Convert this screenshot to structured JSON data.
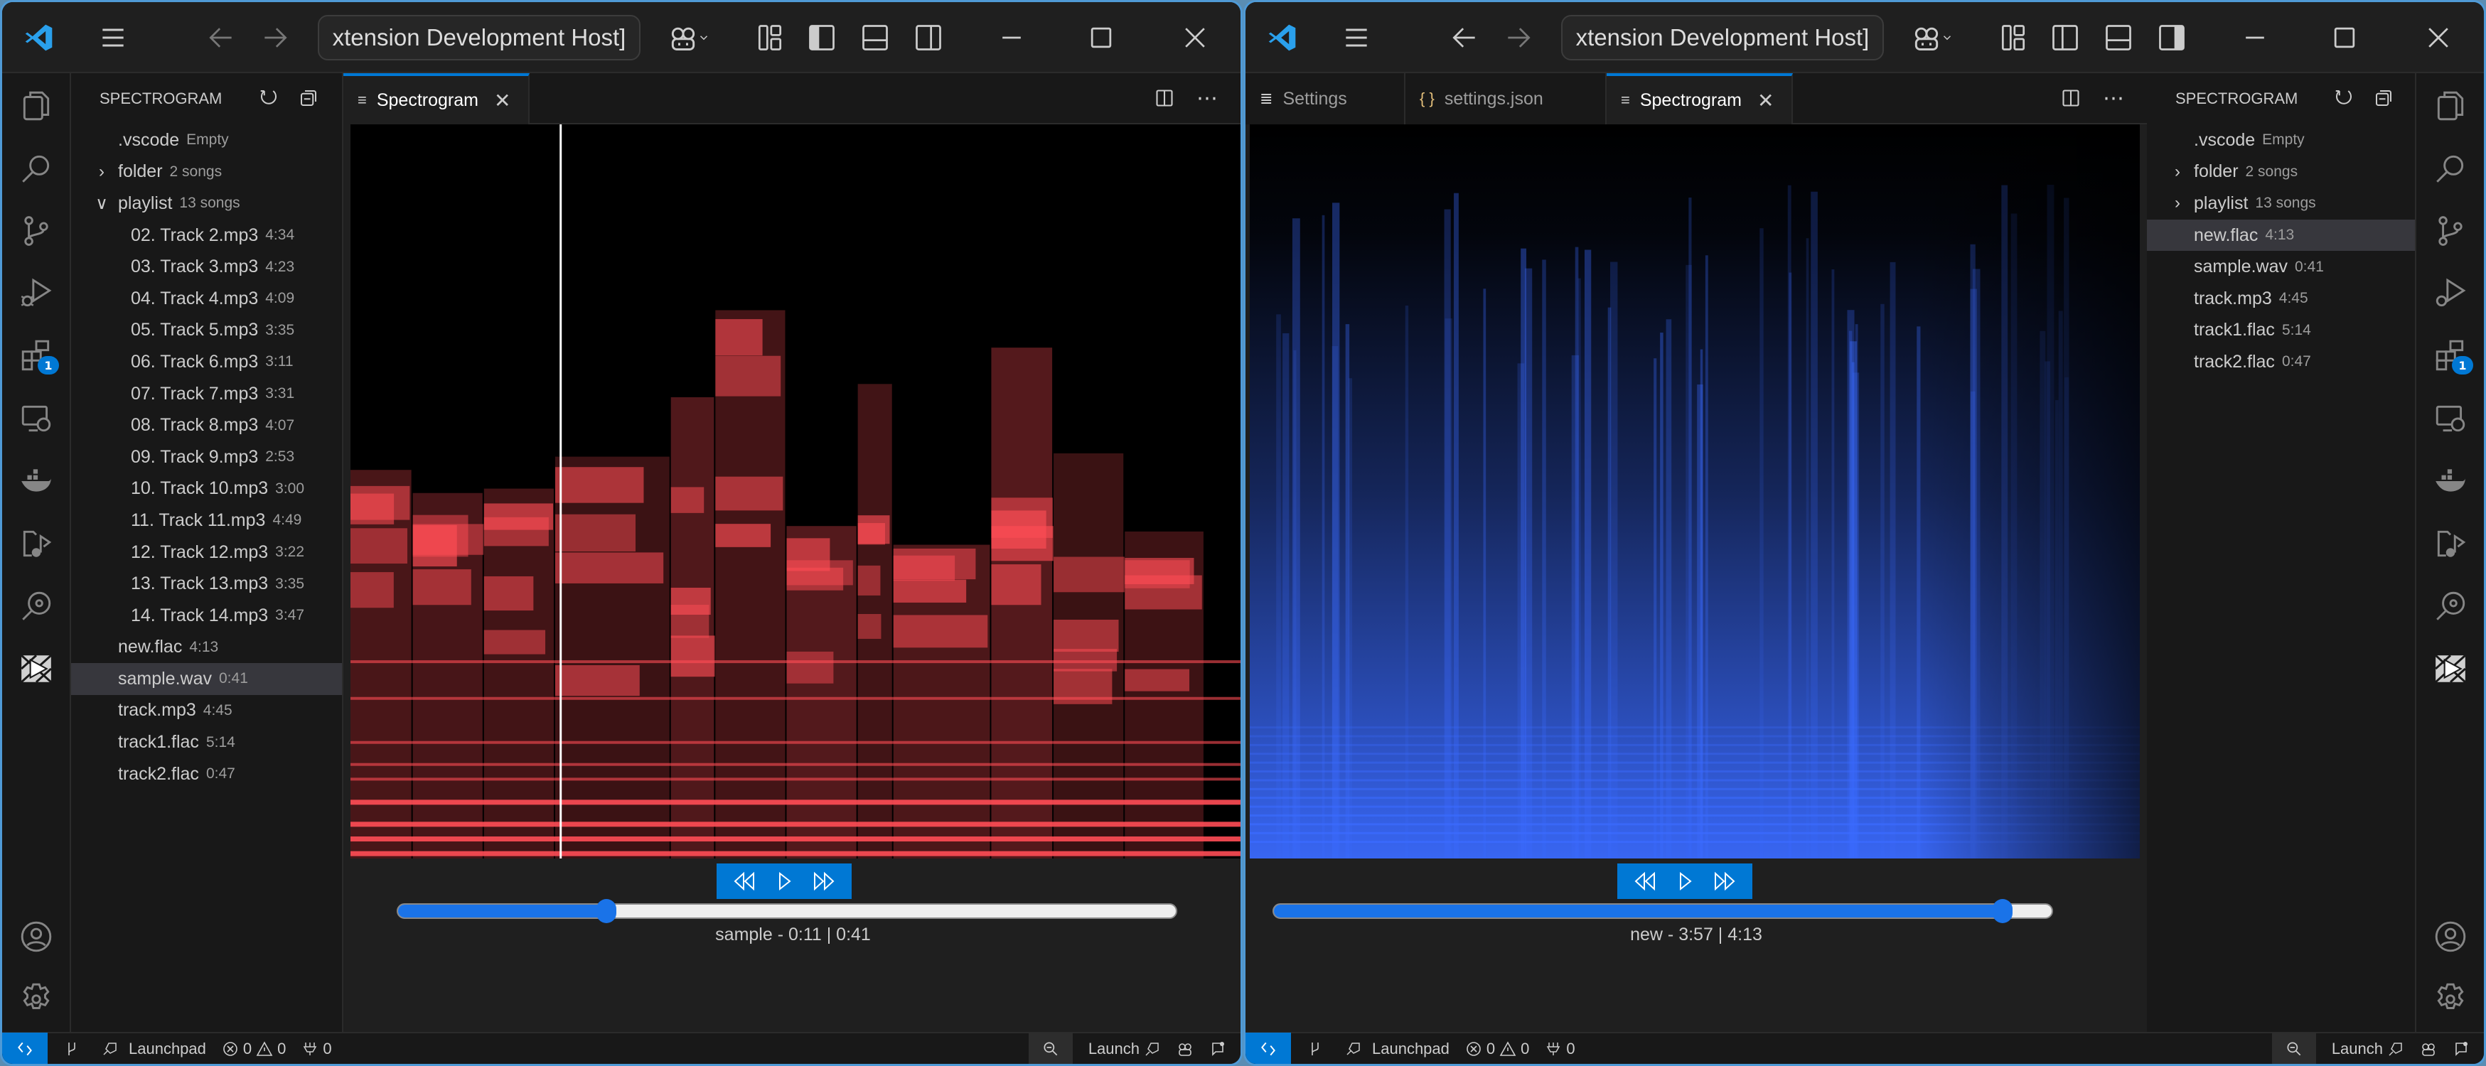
{
  "windows": [
    {
      "id": "left",
      "title": "xtension Development Host]",
      "sidebar": {
        "title": "SPECTROGRAM",
        "refresh_label": "Refresh",
        "collapse_label": "Collapse All",
        "items": [
          {
            "name": ".vscode",
            "desc": "Empty",
            "level": 0,
            "chevron": "none"
          },
          {
            "name": "folder",
            "desc": "2 songs",
            "level": 0,
            "chevron": "right"
          },
          {
            "name": "playlist",
            "desc": "13 songs",
            "level": 0,
            "chevron": "down"
          },
          {
            "name": "02. Track 2.mp3",
            "desc": "4:34",
            "level": 1
          },
          {
            "name": "03. Track 3.mp3",
            "desc": "4:23",
            "level": 1
          },
          {
            "name": "04. Track 4.mp3",
            "desc": "4:09",
            "level": 1
          },
          {
            "name": "05. Track 5.mp3",
            "desc": "3:35",
            "level": 1
          },
          {
            "name": "06. Track 6.mp3",
            "desc": "3:11",
            "level": 1
          },
          {
            "name": "07. Track 7.mp3",
            "desc": "3:31",
            "level": 1
          },
          {
            "name": "08. Track 8.mp3",
            "desc": "4:07",
            "level": 1
          },
          {
            "name": "09. Track 9.mp3",
            "desc": "2:53",
            "level": 1
          },
          {
            "name": "10. Track 10.mp3",
            "desc": "3:00",
            "level": 1
          },
          {
            "name": "11. Track 11.mp3",
            "desc": "4:49",
            "level": 1
          },
          {
            "name": "12. Track 12.mp3",
            "desc": "3:22",
            "level": 1
          },
          {
            "name": "13. Track 13.mp3",
            "desc": "3:35",
            "level": 1
          },
          {
            "name": "14. Track 14.mp3",
            "desc": "3:47",
            "level": 1
          },
          {
            "name": "new.flac",
            "desc": "4:13",
            "level": 0,
            "chevron": "none"
          },
          {
            "name": "sample.wav",
            "desc": "0:41",
            "level": 0,
            "chevron": "none",
            "selected": true
          },
          {
            "name": "track.mp3",
            "desc": "4:45",
            "level": 0,
            "chevron": "none"
          },
          {
            "name": "track1.flac",
            "desc": "5:14",
            "level": 0,
            "chevron": "none"
          },
          {
            "name": "track2.flac",
            "desc": "0:47",
            "level": 0,
            "chevron": "none"
          }
        ]
      },
      "tabs": [
        {
          "label": "Spectrogram",
          "icon": "preview-icon",
          "active": true,
          "closable": true
        }
      ],
      "spectrogram": {
        "colormap": "red",
        "color": "#ff4d55",
        "playhead_fraction": 0.268
      },
      "player": {
        "rewind_label": "Rewind",
        "play_label": "Play",
        "forward_label": "Fast forward",
        "progress": 0.268,
        "now_playing": "sample - 0:11 | 0:41"
      },
      "status": {
        "remote": "><",
        "launchpad": "Launchpad",
        "errors": "0",
        "warnings": "0",
        "ports": "0",
        "launch": "Launch"
      }
    },
    {
      "id": "right",
      "title": "xtension Development Host]",
      "sidebar": {
        "title": "SPECTROGRAM",
        "refresh_label": "Refresh",
        "collapse_label": "Collapse All",
        "items": [
          {
            "name": ".vscode",
            "desc": "Empty",
            "level": 0,
            "chevron": "none"
          },
          {
            "name": "folder",
            "desc": "2 songs",
            "level": 0,
            "chevron": "right"
          },
          {
            "name": "playlist",
            "desc": "13 songs",
            "level": 0,
            "chevron": "right"
          },
          {
            "name": "new.flac",
            "desc": "4:13",
            "level": 0,
            "chevron": "none",
            "selected": true
          },
          {
            "name": "sample.wav",
            "desc": "0:41",
            "level": 0,
            "chevron": "none"
          },
          {
            "name": "track.mp3",
            "desc": "4:45",
            "level": 0,
            "chevron": "none"
          },
          {
            "name": "track1.flac",
            "desc": "5:14",
            "level": 0,
            "chevron": "none"
          },
          {
            "name": "track2.flac",
            "desc": "0:47",
            "level": 0,
            "chevron": "none"
          }
        ]
      },
      "tabs": [
        {
          "label": "Settings",
          "icon": "settings-icon",
          "active": false,
          "closable": false
        },
        {
          "label": "settings.json",
          "icon": "json-icon",
          "active": false,
          "closable": false
        },
        {
          "label": "Spectrogram",
          "icon": "preview-icon",
          "active": true,
          "closable": true
        }
      ],
      "spectrogram": {
        "colormap": "blue",
        "color": "#3b6bff",
        "playhead_fraction": null
      },
      "player": {
        "rewind_label": "Rewind",
        "play_label": "Play",
        "forward_label": "Fast forward",
        "progress": 0.937,
        "now_playing": "new - 3:57 | 4:13"
      },
      "status": {
        "remote": "><",
        "launchpad": "Launchpad",
        "errors": "0",
        "warnings": "0",
        "ports": "0",
        "launch": "Launch"
      }
    }
  ],
  "activity_bar": {
    "items": [
      "explorer",
      "search",
      "source-control",
      "run-debug",
      "extensions",
      "remote-explorer",
      "docker",
      "music-files",
      "spectrogram-search",
      "spectrogram-view"
    ],
    "extensions_badge": "1",
    "bottom": [
      "accounts",
      "manage"
    ]
  },
  "colors": {
    "accent": "#0078d4",
    "slider_fill": "#1a73e8",
    "selection": "#37373d",
    "background": "#181818",
    "editor_background": "#1f1f1f"
  }
}
